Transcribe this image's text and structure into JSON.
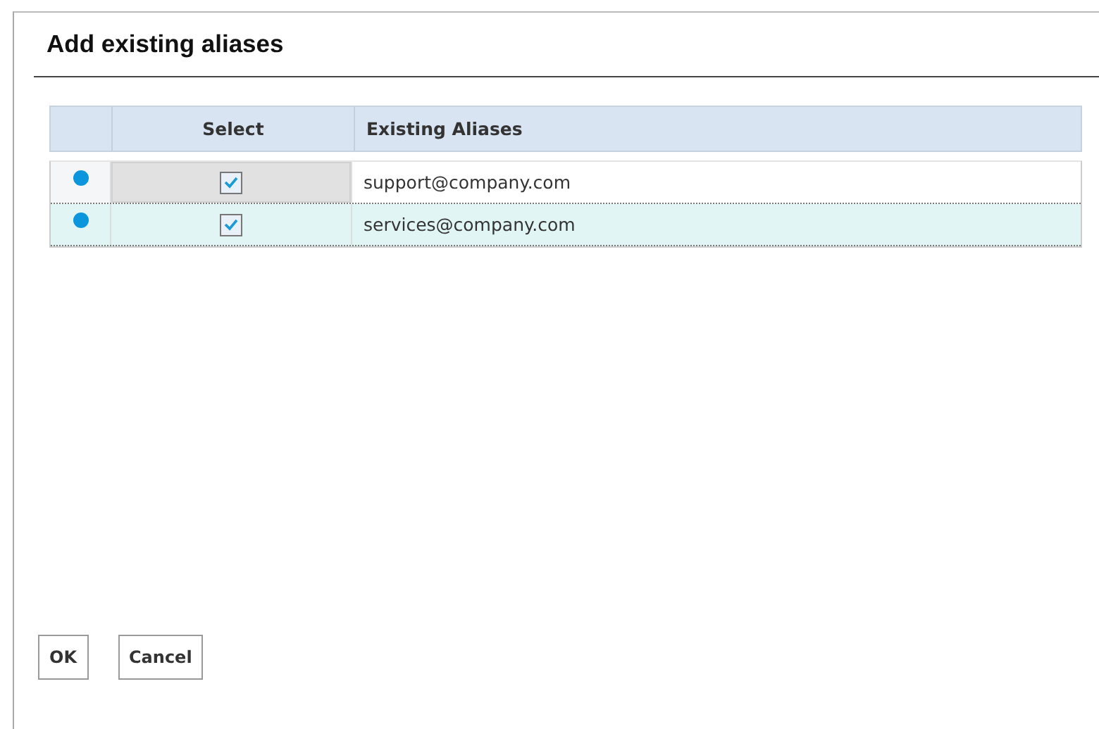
{
  "dialog": {
    "title": "Add existing aliases"
  },
  "table": {
    "columns": [
      "Select",
      "Existing Aliases"
    ],
    "rows": [
      {
        "checked": true,
        "alias": "support@company.com",
        "selected": false,
        "focused": true
      },
      {
        "checked": true,
        "alias": "services@company.com",
        "selected": true,
        "focused": false
      }
    ]
  },
  "buttons": [
    "OK",
    "Cancel"
  ]
}
